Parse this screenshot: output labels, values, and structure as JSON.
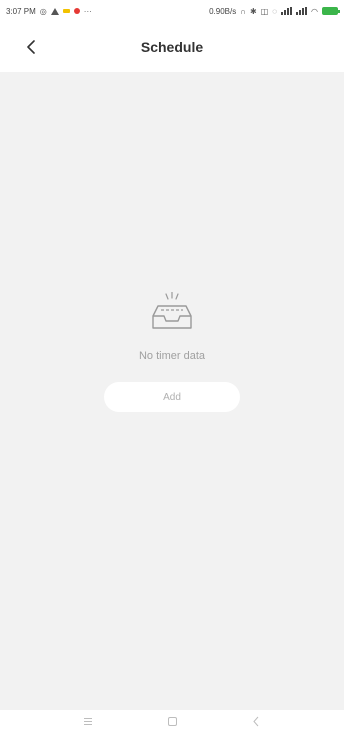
{
  "status_bar": {
    "time": "3:07 PM",
    "speed": "0.90B/s",
    "colors": {
      "yellow_dot": "#f2c200",
      "red_dot": "#e53935",
      "battery": "#3bb54a"
    },
    "icons": [
      "alarm-icon",
      "warning-icon",
      "headphones-icon",
      "bluetooth-icon",
      "nfc-icon",
      "signal-icon",
      "wifi-icon",
      "battery-icon"
    ]
  },
  "header": {
    "title": "Schedule",
    "back_icon": "chevron-left-icon"
  },
  "empty_state": {
    "icon": "empty-tray-icon",
    "message": "No timer data",
    "add_label": "Add"
  },
  "nav_bar": {
    "icons": [
      "menu-icon",
      "home-square-icon",
      "back-icon"
    ]
  }
}
